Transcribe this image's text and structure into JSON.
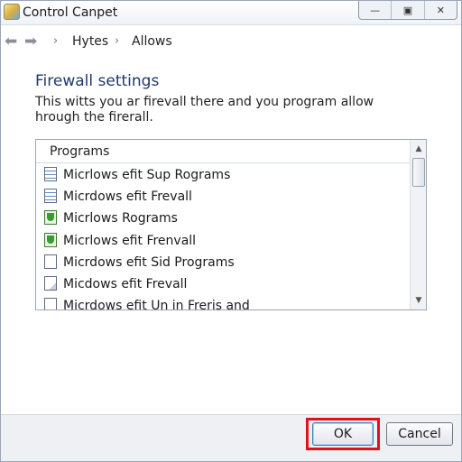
{
  "window": {
    "title": "Control Canpet",
    "controls": {
      "minimize": "—",
      "maximize": "▣",
      "close": "✕"
    }
  },
  "nav": {
    "back_icon": "back-arrow-icon",
    "forward_icon": "forward-arrow-icon",
    "separator": "›",
    "breadcrumb": [
      "Hytes",
      "Allows"
    ]
  },
  "content": {
    "heading": "Firewall settings",
    "description": "This witts you ar firevall there and you program allow hrough the firerall."
  },
  "programs_list": {
    "header": "Programs",
    "items": [
      {
        "label": "Micrlows efit Sup Rograms",
        "icon": "doc-blue"
      },
      {
        "label": "Micrdows efit Frevall",
        "icon": "doc-blue"
      },
      {
        "label": "Micrlows Rograms",
        "icon": "shield-green"
      },
      {
        "label": "Micrlows efit Frenvall",
        "icon": "shield-green"
      },
      {
        "label": "Micrdows efit Sid Programs",
        "icon": "doc-plain"
      },
      {
        "label": "Micdows efit Frevall",
        "icon": "doc-fold"
      },
      {
        "label": "Micrdows efit Un in Freris and",
        "icon": "doc-plain"
      }
    ],
    "scroll_up": "▲",
    "scroll_down": "▼"
  },
  "buttons": {
    "ok": "OK",
    "cancel": "Cancel"
  },
  "colors": {
    "highlight": "#e0101c",
    "heading": "#1d3a6b"
  }
}
